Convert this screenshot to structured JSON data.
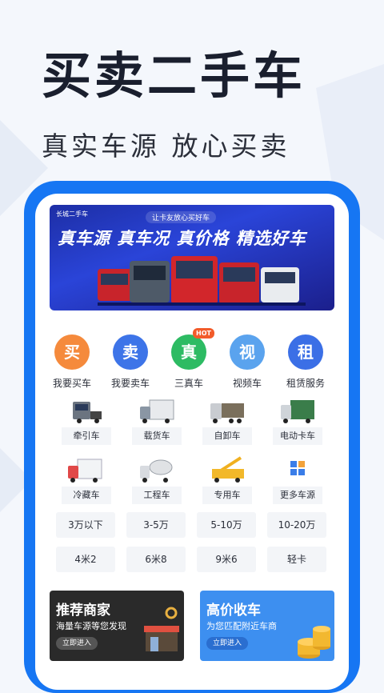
{
  "hero": {
    "title": "买卖二手车",
    "subtitle": "真实车源 放心买卖"
  },
  "banner": {
    "logo": "长城二手车",
    "tag": "让卡友放心买好车",
    "slogan": "真车源 真车况 真价格 精选好车"
  },
  "quick_actions": [
    {
      "char": "买",
      "label": "我要买车",
      "color": "#f58a3c"
    },
    {
      "char": "卖",
      "label": "我要卖车",
      "color": "#3d74e8"
    },
    {
      "char": "真",
      "label": "三真车",
      "color": "#2dbb63",
      "badge": "HOT"
    },
    {
      "char": "视",
      "label": "视频车",
      "color": "#5aa3ee"
    },
    {
      "char": "租",
      "label": "租赁服务",
      "color": "#3b6fe6"
    }
  ],
  "categories": [
    {
      "label": "牵引车",
      "icon": "tractor-truck-icon"
    },
    {
      "label": "载货车",
      "icon": "cargo-truck-icon"
    },
    {
      "label": "自卸车",
      "icon": "dump-truck-icon"
    },
    {
      "label": "电动卡车",
      "icon": "electric-truck-icon"
    },
    {
      "label": "冷藏车",
      "icon": "refrigerated-truck-icon"
    },
    {
      "label": "工程车",
      "icon": "engineering-truck-icon"
    },
    {
      "label": "专用车",
      "icon": "special-truck-icon"
    },
    {
      "label": "更多车源",
      "icon": "more-grid-icon"
    }
  ],
  "price_filters": [
    "3万以下",
    "3-5万",
    "5-10万",
    "10-20万"
  ],
  "size_filters": [
    "4米2",
    "6米8",
    "9米6",
    "轻卡"
  ],
  "promos": [
    {
      "title": "推荐商家",
      "subtitle": "海量车源等您发现",
      "button": "立即进入",
      "color": "#2a2a2a"
    },
    {
      "title": "高价收车",
      "subtitle": "为您匹配附近车商",
      "button": "立即进入",
      "color": "#3d8ff0"
    }
  ]
}
